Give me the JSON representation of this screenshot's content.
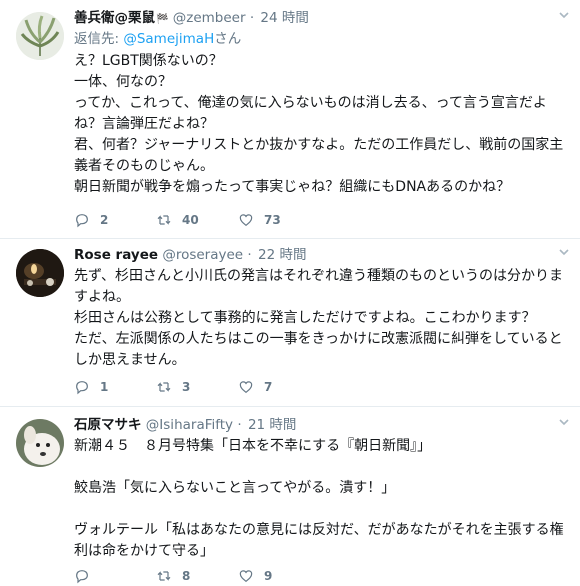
{
  "tweets": [
    {
      "name": "善兵衛@栗鼠",
      "handle": "@zembeer",
      "dot": "·",
      "time": "24 時間",
      "reply_prefix": "返信先: ",
      "reply_mention": "@SamejimaH",
      "reply_suffix": "さん",
      "text": "え？LGBT関係ないの？\n一体、何なの？\nってか、これって、俺達の気に入らないものは消し去る、って言う宣言だよね？言論弾圧だよね？\n君、何者？ジャーナリストとか抜かすなよ。ただの工作員だし、戦前の国家主義者そのものじゃん。\n朝日新聞が戦争を煽ったって事実じゃね？組織にもDNAあるのかね？",
      "replies": "2",
      "retweets": "40",
      "likes": "73"
    },
    {
      "name": "Rose rayee",
      "handle": "@roserayee",
      "dot": "·",
      "time": "22 時間",
      "text": "先ず、杉田さんと小川氏の発言はそれぞれ違う種類のものというのは分かりますよね。\n杉田さんは公務として事務的に発言しただけですよね。ここわかります？\nただ、左派関係の人たちはこの一事をきっかけに改憲派閥に糾弾をしているとしか思えません。",
      "replies": "1",
      "retweets": "3",
      "likes": "7"
    },
    {
      "name": "石原マサキ",
      "handle": "@IsiharaFifty",
      "dot": "·",
      "time": "21 時間",
      "text": "新潮４５　８月号特集「日本を不幸にする『朝日新聞』」\n\n鮫島浩「気に入らないこと言ってやがる。潰す！」\n\nヴォルテール「私はあなたの意見には反対だ、だがあなたがそれを主張する権利は命をかけて守る」",
      "replies": "",
      "retweets": "8",
      "likes": "9"
    }
  ],
  "icons": {
    "reply": "reply-icon",
    "retweet": "retweet-icon",
    "like": "heart-icon",
    "more": "chevron-down-icon"
  },
  "colors": {
    "link": "#1da1f2",
    "secondary_text": "#657786",
    "divider": "#e6ecf0"
  }
}
